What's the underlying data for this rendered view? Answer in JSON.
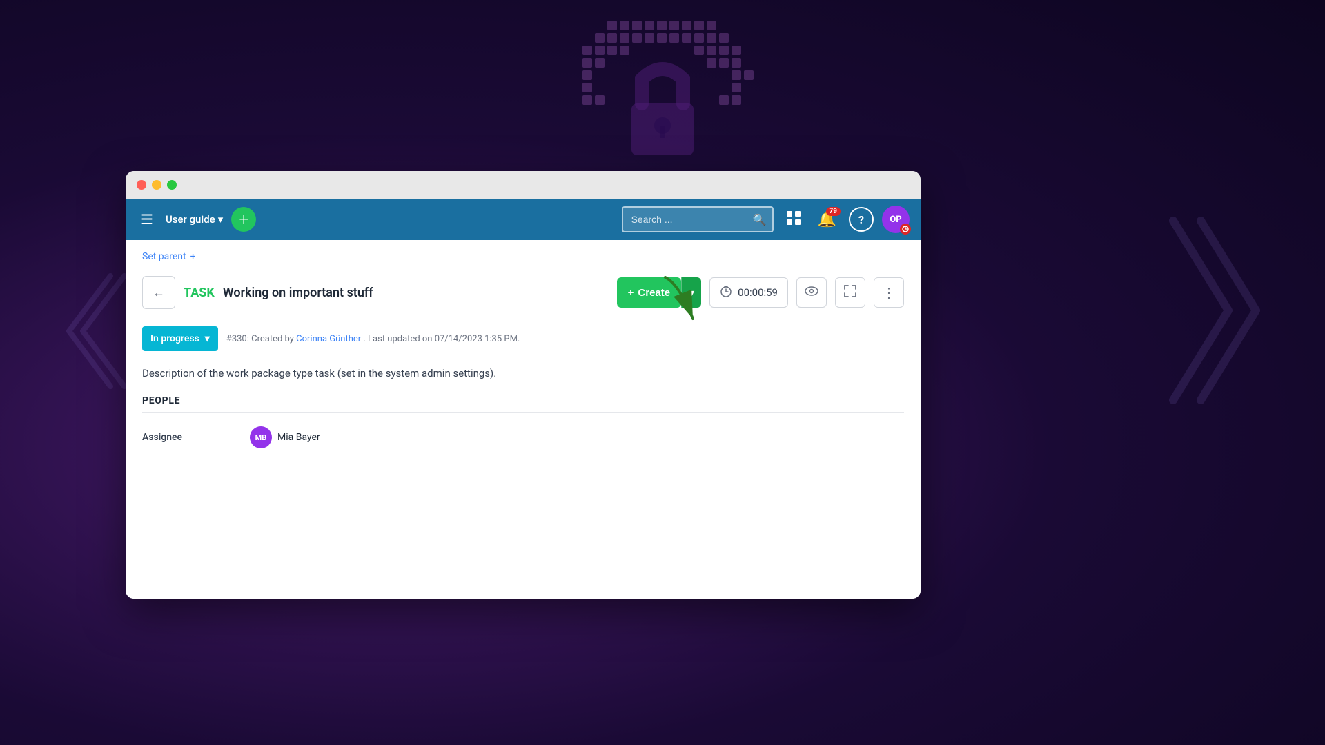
{
  "background": {
    "description": "dark purple gradient background"
  },
  "window": {
    "traffic_lights": [
      "red",
      "yellow",
      "green"
    ]
  },
  "navbar": {
    "menu_icon": "☰",
    "user_guide_label": "User guide",
    "user_guide_dropdown": "▾",
    "add_button_icon": "+",
    "search_placeholder": "Search ...",
    "search_icon": "🔍",
    "grid_icon": "⊞",
    "notification_count": "79",
    "help_label": "?",
    "avatar_initials": "OP",
    "avatar_timer_icon": "🕐"
  },
  "content": {
    "set_parent_label": "Set parent",
    "set_parent_icon": "+",
    "back_button_icon": "←",
    "task_type": "TASK",
    "task_title": "Working on important stuff",
    "create_button_label": "+ Create",
    "create_dropdown_icon": "▾",
    "timer_value": "00:00:59",
    "timer_icon": "⏱",
    "watch_icon": "👁",
    "fullscreen_icon": "⤢",
    "more_icon": "⋮",
    "status_label": "In progress",
    "status_dropdown": "▾",
    "meta_text": "#330: Created by",
    "meta_author": "Corinna Günther",
    "meta_suffix": ". Last updated on 07/14/2023 1:35 PM.",
    "description": "Description of the work package type task (set in the system admin settings).",
    "people_section_title": "PEOPLE",
    "assignee_label": "Assignee",
    "assignee_avatar": "MB",
    "assignee_name": "Mia Bayer"
  },
  "colors": {
    "navbar_bg": "#1a6fa0",
    "add_btn_bg": "#22c55e",
    "status_bg": "#06b6d4",
    "task_type_color": "#22c55e",
    "avatar_bg": "#9333ea",
    "assignee_avatar_bg": "#9333ea"
  }
}
